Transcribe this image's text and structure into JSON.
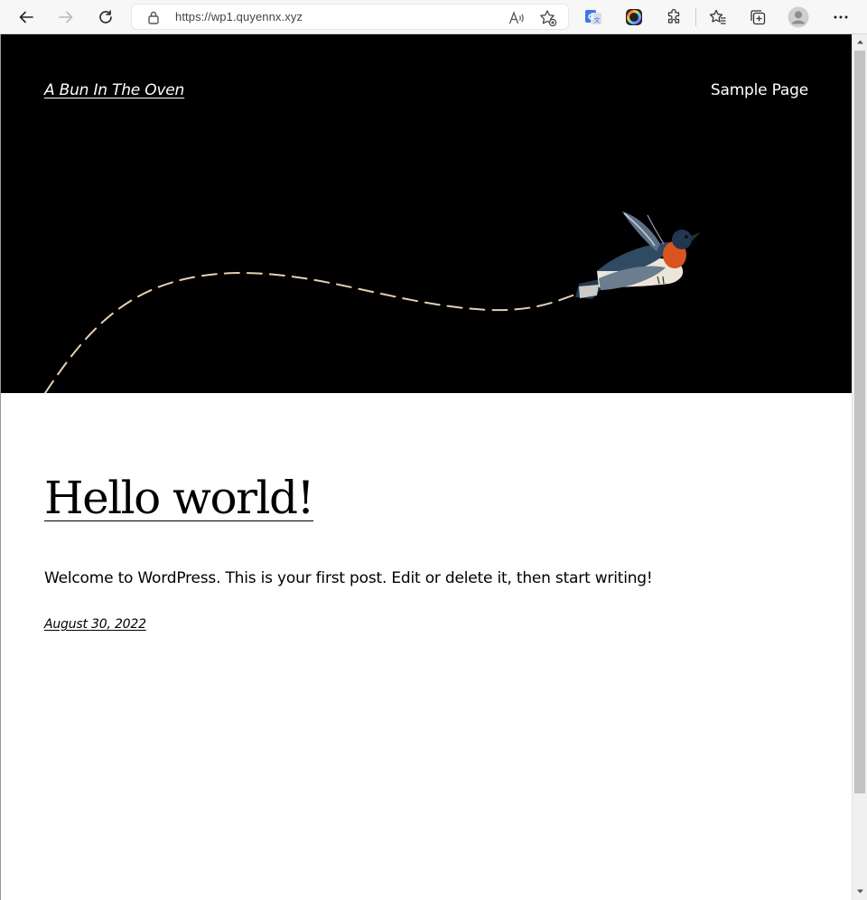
{
  "browser": {
    "url": "https://wp1.quyennx.xyz"
  },
  "site": {
    "title": "A Bun In The Oven",
    "nav": [
      {
        "label": "Sample Page"
      }
    ]
  },
  "post": {
    "title": "Hello world!",
    "excerpt": "Welcome to WordPress. This is your first post. Edit or delete it, then start writing!",
    "date": "August 30, 2022"
  },
  "colors": {
    "hero_bg": "#000000",
    "dashed_path": "#e6cfb2",
    "bird_breast": "#d9541e",
    "bird_back": "#2f4a63"
  },
  "icons": [
    "back-arrow-icon",
    "forward-arrow-icon",
    "refresh-icon",
    "lock-icon",
    "read-aloud-icon",
    "add-favorite-icon",
    "translate-extension-icon",
    "color-extension-icon",
    "extensions-icon",
    "favorites-icon",
    "collections-icon",
    "profile-avatar-icon",
    "more-options-icon"
  ]
}
